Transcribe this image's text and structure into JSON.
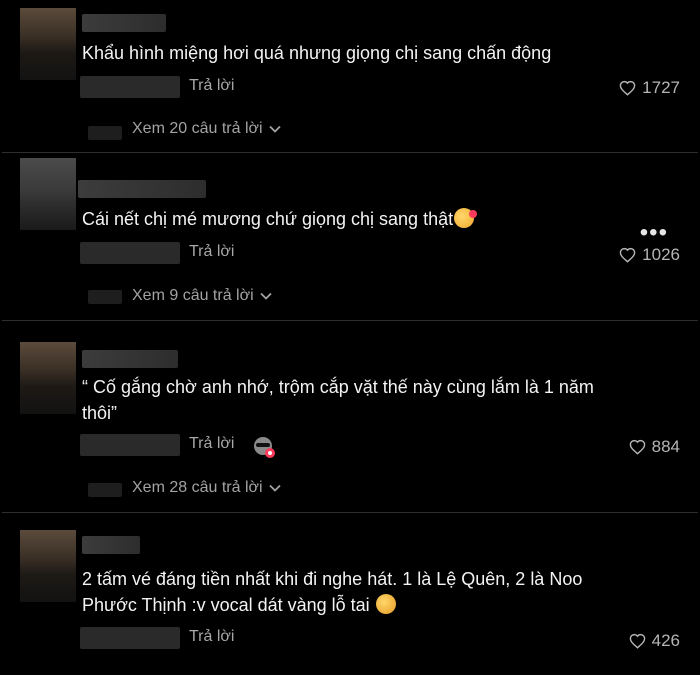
{
  "comments": [
    {
      "text": "Khẩu hình miệng hơi quá nhưng giọng chị sang chấn động",
      "reply_label": "Trả lời",
      "likes": "1727",
      "view_replies": "Xem 20 câu trả lời"
    },
    {
      "text": "Cái nết chị mé mương chứ giọng chị sang thật",
      "emoji": "smiling-face-with-hearts",
      "reply_label": "Trả lời",
      "likes": "1026",
      "view_replies": "Xem 9 câu trả lời"
    },
    {
      "text": "“ Cố gắng chờ anh nhớ, trộm cắp vặt thế này cùng lắm là 1 năm thôi”",
      "sticker": "sunglasses-sticker",
      "reply_label": "Trả lời",
      "likes": "884",
      "view_replies": "Xem 28 câu trả lời"
    },
    {
      "text": "2 tấm vé đáng tiền nhất khi đi nghe hát. 1 là Lệ Quên, 2 là Noo Phước Thịnh :v vocal dát vàng lỗ tai",
      "emoji": "rolling-on-floor-laughing",
      "reply_label": "Trả lời",
      "likes": "426"
    }
  ],
  "more_menu_icon": "more-horizontal-icon",
  "colors": {
    "background": "#000000",
    "text": "#f3f3f3",
    "muted": "#a7a7a7",
    "frame": "#ffdd00"
  }
}
